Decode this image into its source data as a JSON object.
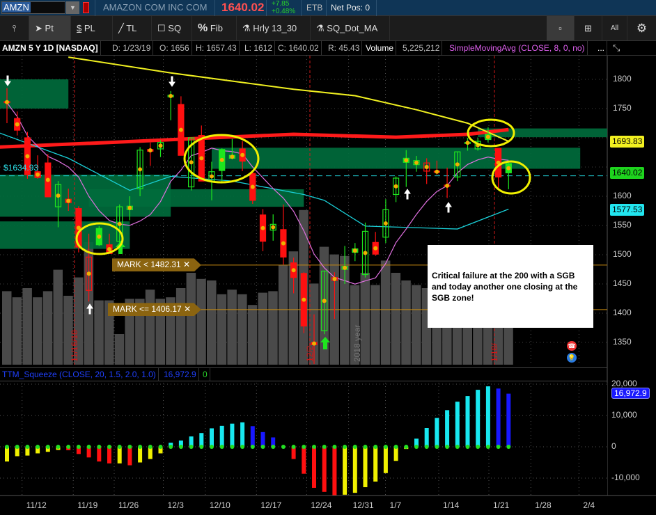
{
  "header": {
    "symbol": "AMZN",
    "company": "AMAZON COM INC COM",
    "last": "1640.02",
    "change": "+7.85",
    "change_pct": "+0.48%",
    "etb": "ETB",
    "net_pos": "Net Pos: 0"
  },
  "toolbar": {
    "items": [
      {
        "label": "Pt",
        "icon": "cursor-icon"
      },
      {
        "label": "PL",
        "icon": "price-level-icon"
      },
      {
        "label": "TL",
        "icon": "trendline-icon"
      },
      {
        "label": "SQ",
        "icon": "square-icon"
      },
      {
        "label": "Fib",
        "icon": "percent-icon"
      },
      {
        "label": "Hrly 13_30",
        "icon": "flask-icon"
      },
      {
        "label": "SQ_Dot_MA",
        "icon": "flask-icon"
      }
    ],
    "right_all": "All"
  },
  "info": {
    "title": "AMZN 5 Y 1D [NASDAQ]",
    "date": "D: 1/23/19",
    "open": "O: 1656",
    "high": "H: 1657.43",
    "low": "L: 1612",
    "close": "C: 1640.02",
    "range": "R: 45.43",
    "volume_label": "Volume",
    "volume": "5,225,212",
    "study": "SimpleMovingAvg (CLOSE, 8, 0, no)",
    "more": "..."
  },
  "price_axis": {
    "ticks": [
      "1800",
      "1750",
      "1600",
      "1550",
      "1500",
      "1450",
      "1400",
      "1350"
    ],
    "tick_values": [
      1800,
      1750,
      1600,
      1550,
      1500,
      1450,
      1400,
      1350
    ],
    "tags": {
      "yellow": "1693.83",
      "green": "1640.02",
      "cyan": "1577.53"
    },
    "left_price": "$1634.93"
  },
  "marks": [
    {
      "label": "MARK < 1482.31 ✕",
      "price": 1482.31
    },
    {
      "label": "MARK <= 1406.17 ✕",
      "price": 1406.17
    }
  ],
  "note": "Critical failure at the 200 with a SGB and today another one closing at the SGB zone!",
  "vlabels": {
    "a": "11/16/18",
    "b": "12/2",
    "c": "2018 year",
    "d": "1/18/"
  },
  "colors": {
    "up": "#1ee61e",
    "down": "#ff1010",
    "sma_yellow": "#f0f020",
    "sma_red": "#ff1a1a",
    "sma_cyan": "#1ad0d8",
    "sma_magenta": "#e070e0",
    "zone": "#006b3c",
    "dot": "#f0b000"
  },
  "candles": [
    [
      1762,
      1785,
      1725,
      1760,
      "r"
    ],
    [
      1733,
      1745,
      1704,
      1713,
      "r"
    ],
    [
      1700,
      1710,
      1630,
      1637,
      "r"
    ],
    [
      1642,
      1670,
      1630,
      1632,
      "r"
    ],
    [
      1657,
      1672,
      1599,
      1599,
      "r"
    ],
    [
      1582,
      1626,
      1547,
      1620,
      "g"
    ],
    [
      1595,
      1613,
      1575,
      1589,
      "r"
    ],
    [
      1579,
      1583,
      1504,
      1513,
      "r"
    ],
    [
      1439,
      1536,
      1420,
      1496,
      "r"
    ],
    [
      1545,
      1549,
      1515,
      1517,
      "g"
    ],
    [
      1517,
      1536,
      1502,
      1502,
      "r"
    ],
    [
      1523,
      1586,
      1503,
      1582,
      "g"
    ],
    [
      1577,
      1600,
      1559,
      1583,
      "g"
    ],
    [
      1613,
      1684,
      1600,
      1679,
      "g"
    ],
    [
      1680,
      1692,
      1652,
      1677,
      "r"
    ],
    [
      1681,
      1696,
      1667,
      1692,
      "g"
    ],
    [
      1770,
      1780,
      1730,
      1773,
      "g"
    ],
    [
      1757,
      1771,
      1670,
      1670,
      "r"
    ],
    [
      1616,
      1700,
      1610,
      1700,
      "g"
    ],
    [
      1704,
      1721,
      1626,
      1626,
      "r"
    ],
    [
      1626,
      1659,
      1593,
      1642,
      "g"
    ],
    [
      1680,
      1682,
      1622,
      1644,
      "g"
    ],
    [
      1670,
      1698,
      1663,
      1665,
      "g"
    ],
    [
      1681,
      1694,
      1643,
      1660,
      "r"
    ],
    [
      1639,
      1643,
      1587,
      1593,
      "r"
    ],
    [
      1568,
      1578,
      1506,
      1523,
      "r"
    ],
    [
      1542,
      1569,
      1524,
      1552,
      "g"
    ],
    [
      1543,
      1586,
      1483,
      1496,
      "r"
    ],
    [
      1486,
      1495,
      1434,
      1461,
      "r"
    ],
    [
      1468,
      1470,
      1366,
      1378,
      "r"
    ],
    [
      1350,
      1398,
      1313,
      1346,
      "r"
    ],
    [
      1370,
      1473,
      1364,
      1472,
      "g"
    ],
    [
      1456,
      1470,
      1390,
      1461,
      "r"
    ],
    [
      1475,
      1515,
      1450,
      1480,
      "g"
    ],
    [
      1510,
      1520,
      1489,
      1504,
      "g"
    ],
    [
      1466,
      1555,
      1461,
      1540,
      "g"
    ],
    [
      1521,
      1539,
      1498,
      1501,
      "r"
    ],
    [
      1530,
      1595,
      1520,
      1577,
      "g"
    ],
    [
      1603,
      1634,
      1590,
      1631,
      "g"
    ],
    [
      1665,
      1679,
      1616,
      1658,
      "g"
    ],
    [
      1654,
      1669,
      1642,
      1661,
      "g"
    ],
    [
      1643,
      1665,
      1621,
      1657,
      "r"
    ],
    [
      1643,
      1661,
      1637,
      1641,
      "r"
    ],
    [
      1617,
      1649,
      1597,
      1619,
      "r"
    ],
    [
      1633,
      1676,
      1626,
      1676,
      "g"
    ],
    [
      1691,
      1700,
      1678,
      1692,
      "g"
    ],
    [
      1681,
      1700,
      1678,
      1694,
      "g"
    ],
    [
      1706,
      1718,
      1692,
      1697,
      "g"
    ],
    [
      1682,
      1682,
      1611,
      1633,
      "r"
    ],
    [
      1656,
      1657.43,
      1612,
      1640.02,
      "g"
    ]
  ],
  "volume_millions": [
    4.8,
    4.4,
    5.0,
    4.4,
    4.8,
    6.2,
    4.5,
    5.7,
    8.0,
    4.2,
    4.2,
    2.0,
    4.3,
    4.3,
    4.9,
    4.3,
    4.4,
    5.0,
    6.0,
    5.6,
    5.5,
    4.6,
    4.9,
    4.6,
    3.9,
    4.7,
    4.8,
    6.5,
    7.4,
    10.1,
    5.3,
    7.7,
    7.2,
    7.1,
    5.2,
    6.0,
    5.2,
    6.8,
    6.0,
    5.5,
    5.2,
    5.0,
    4.8,
    5.0,
    5.2,
    5.5,
    5.7,
    6.4,
    7.7,
    5.2
  ],
  "sma_yellow": [
    [
      6,
      1838
    ],
    [
      16,
      1811
    ],
    [
      28,
      1783
    ],
    [
      34,
      1772
    ],
    [
      40,
      1748
    ],
    [
      45,
      1725
    ],
    [
      49,
      1694
    ]
  ],
  "sma_red": [
    [
      -1,
      1684
    ],
    [
      10,
      1692
    ],
    [
      20,
      1700
    ],
    [
      28,
      1706
    ],
    [
      38,
      1701
    ],
    [
      45,
      1706
    ],
    [
      49,
      1714
    ]
  ],
  "sma_cyan": [
    [
      -1,
      1710
    ],
    [
      6,
      1665
    ],
    [
      12,
      1610
    ],
    [
      16,
      1634
    ],
    [
      22,
      1626
    ],
    [
      29,
      1603
    ],
    [
      31,
      1593
    ],
    [
      35,
      1549
    ],
    [
      44,
      1544
    ],
    [
      49,
      1578
    ]
  ],
  "zones": [
    [
      -1,
      6,
      1800,
      1750
    ],
    [
      -1,
      16,
      1637,
      1565
    ],
    [
      8,
      29,
      1612,
      1582
    ],
    [
      -1,
      12,
      1557,
      1510
    ],
    [
      20,
      56,
      1683,
      1647
    ],
    [
      46,
      59,
      1716,
      1701
    ]
  ],
  "ttm": {
    "title": "TTM_Squeeze (CLOSE, 20, 1.5, 2.0, 1.0)",
    "value": "16,972.9",
    "squeeze": "0",
    "axis": [
      "20,000",
      "10,000",
      "0",
      "-10,000"
    ],
    "axis_values": [
      20000,
      10000,
      0,
      -10000
    ],
    "hist": [
      [
        -4700,
        "y"
      ],
      [
        -3000,
        "y"
      ],
      [
        -2800,
        "y"
      ],
      [
        -2100,
        "y"
      ],
      [
        -1600,
        "y"
      ],
      [
        -1000,
        "y"
      ],
      [
        -1100,
        "r"
      ],
      [
        -2300,
        "r"
      ],
      [
        -3400,
        "r"
      ],
      [
        -4700,
        "r"
      ],
      [
        -5300,
        "r"
      ],
      [
        -5300,
        "y"
      ],
      [
        -5900,
        "r"
      ],
      [
        -5000,
        "y"
      ],
      [
        -3900,
        "y"
      ],
      [
        -2100,
        "y"
      ],
      [
        1300,
        "c"
      ],
      [
        2000,
        "c"
      ],
      [
        3300,
        "c"
      ],
      [
        4400,
        "c"
      ],
      [
        5900,
        "c"
      ],
      [
        6700,
        "c"
      ],
      [
        7400,
        "c"
      ],
      [
        7800,
        "c"
      ],
      [
        6600,
        "b"
      ],
      [
        4700,
        "b"
      ],
      [
        3000,
        "b"
      ],
      [
        0,
        "c"
      ],
      [
        -3900,
        "r"
      ],
      [
        -8600,
        "r"
      ],
      [
        -13100,
        "r"
      ],
      [
        -14400,
        "r"
      ],
      [
        -15600,
        "r"
      ],
      [
        -15300,
        "y"
      ],
      [
        -14700,
        "y"
      ],
      [
        -12900,
        "y"
      ],
      [
        -11100,
        "y"
      ],
      [
        -8400,
        "y"
      ],
      [
        -4500,
        "y"
      ],
      [
        -700,
        "y"
      ],
      [
        2600,
        "c"
      ],
      [
        6000,
        "c"
      ],
      [
        9200,
        "c"
      ],
      [
        11700,
        "c"
      ],
      [
        14400,
        "c"
      ],
      [
        16200,
        "c"
      ],
      [
        18200,
        "c"
      ],
      [
        19300,
        "c"
      ],
      [
        18600,
        "b"
      ],
      [
        16972.9,
        "b"
      ]
    ]
  },
  "dates": [
    {
      "label": "11/12",
      "idx": 2.7
    },
    {
      "label": "11/19",
      "idx": 7.7
    },
    {
      "label": "11/26",
      "idx": 11.7
    },
    {
      "label": "12/3",
      "idx": 16.5
    },
    {
      "label": "12/10",
      "idx": 20.6
    },
    {
      "label": "12/17",
      "idx": 25.6
    },
    {
      "label": "12/24",
      "idx": 30.5
    },
    {
      "label": "12/31",
      "idx": 34.6
    },
    {
      "label": "1/7",
      "idx": 38.2
    },
    {
      "label": "1/14",
      "idx": 43.4
    },
    {
      "label": "1/21",
      "idx": 48.3
    },
    {
      "label": "1/28",
      "idx": 52.4
    },
    {
      "label": "2/4",
      "idx": 57.1
    }
  ]
}
